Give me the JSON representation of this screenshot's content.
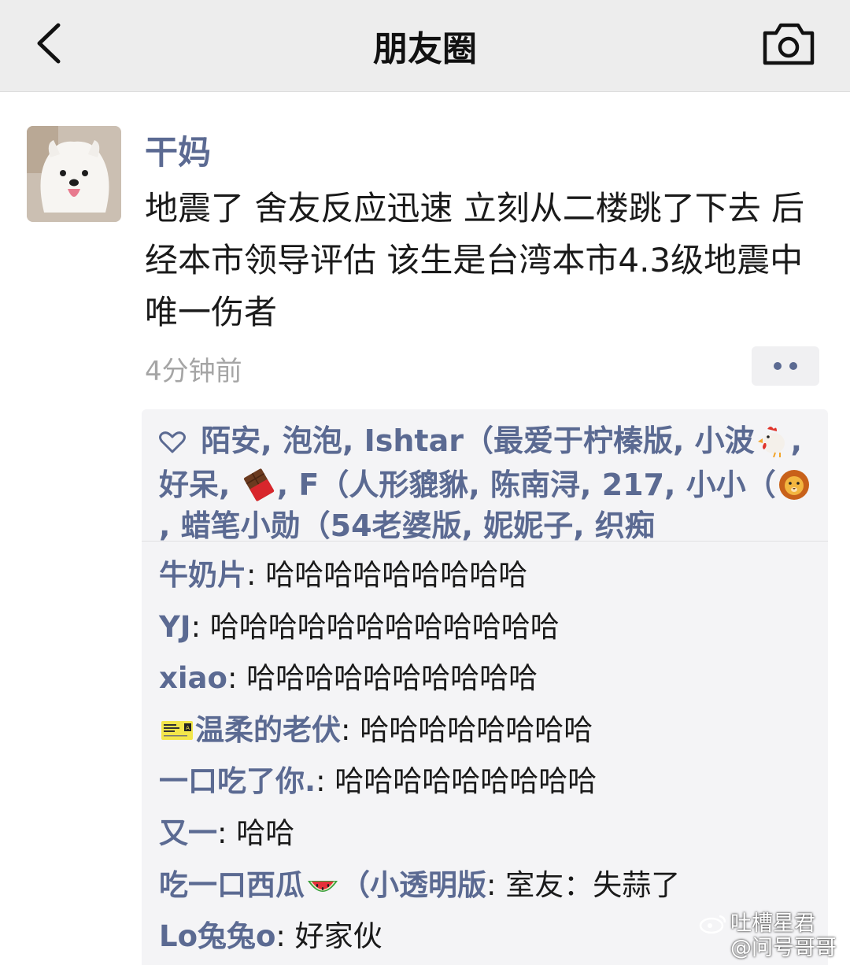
{
  "navbar": {
    "title": "朋友圈",
    "back_icon": "chevron-left-icon",
    "camera_icon": "camera-icon"
  },
  "post": {
    "author": "干妈",
    "avatar": "samoyed-dog-avatar",
    "text": "地震了 舍友反应迅速 立刻从二楼跳了下去 后经本市领导评估 该生是台湾本市4.3级地震中唯一伤者",
    "time": "4分钟前"
  },
  "likes": {
    "icon": "heart-icon",
    "names": [
      {
        "text": "陌安"
      },
      {
        "text": "泡泡"
      },
      {
        "text": "Ishtar（最爱于柠榛版"
      },
      {
        "text": "小波",
        "emoji": "rooster-emoji"
      },
      {
        "text": "好呆"
      },
      {
        "text": "",
        "emoji": "chocolate-emoji"
      },
      {
        "text": "F（人形貔貅"
      },
      {
        "text": "陈南浔"
      },
      {
        "text": "217"
      },
      {
        "text": "小小（",
        "emoji": "lion-emoji"
      },
      {
        "text": "蜡笔小勋（54老婆版"
      },
      {
        "text": "妮妮子"
      },
      {
        "text": "织痴"
      }
    ]
  },
  "comments": [
    {
      "name": "牛奶片",
      "text": "哈哈哈哈哈哈哈哈哈"
    },
    {
      "name": "YJ",
      "text": "哈哈哈哈哈哈哈哈哈哈哈哈"
    },
    {
      "name": "xiao",
      "text": "哈哈哈哈哈哈哈哈哈哈"
    },
    {
      "name": "温柔的老伏",
      "text": "哈哈哈哈哈哈哈哈",
      "emoji": "concert-ticket-emoji"
    },
    {
      "name": "一口吃了你.",
      "text": "哈哈哈哈哈哈哈哈哈"
    },
    {
      "name": "又一",
      "text": "哈哈"
    },
    {
      "name": "吃一口西瓜",
      "emoji_after": "watermelon-emoji",
      "name_tail": "（小透明版",
      "text": "室友：失蒜了"
    },
    {
      "name": "Lo兔兔o",
      "text": "好家伙"
    }
  ],
  "watermark": {
    "line1": "吐槽星君",
    "line2": "@问号哥哥"
  },
  "colors": {
    "link": "#5b6a92",
    "navbar_bg": "#ededed",
    "comment_bg": "#f4f4f6",
    "time": "#a5a5a5"
  }
}
